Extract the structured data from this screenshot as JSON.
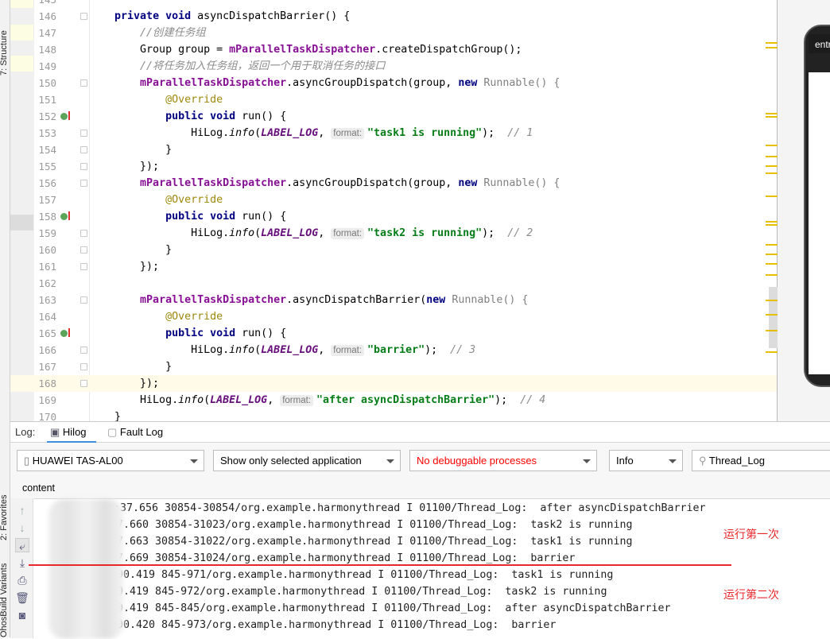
{
  "tool_windows": {
    "structure": "7: Structure",
    "favorites": "2: Favorites",
    "build_variants": "OhosBuild Variants"
  },
  "editor": {
    "current_line": 168,
    "lines": [
      {
        "n": "145",
        "tokens": []
      },
      {
        "n": "146",
        "tokens": [
          [
            "    ",
            ""
          ],
          [
            "private void ",
            "kw"
          ],
          [
            "asyncDispatchBarrier() {",
            ""
          ]
        ]
      },
      {
        "n": "147",
        "tokens": [
          [
            "        ",
            ""
          ],
          [
            "//创建任务组",
            "cm"
          ]
        ]
      },
      {
        "n": "148",
        "tokens": [
          [
            "        Group group = ",
            ""
          ],
          [
            "mParallelTaskDispatcher",
            "fld"
          ],
          [
            ".createDispatchGroup();",
            ""
          ]
        ]
      },
      {
        "n": "149",
        "tokens": [
          [
            "        ",
            ""
          ],
          [
            "//将任务加入任务组，返回一个用于取消任务的接口",
            "cm"
          ]
        ]
      },
      {
        "n": "150",
        "tokens": [
          [
            "        ",
            ""
          ],
          [
            "mParallelTaskDispatcher",
            "fld"
          ],
          [
            ".asyncGroupDispatch(group, ",
            ""
          ],
          [
            "new ",
            "kw"
          ],
          [
            "Runnable() {",
            "gray"
          ]
        ]
      },
      {
        "n": "151",
        "tokens": [
          [
            "            ",
            ""
          ],
          [
            "@Override",
            "ann"
          ]
        ]
      },
      {
        "n": "152",
        "tokens": [
          [
            "            ",
            ""
          ],
          [
            "public void ",
            "kw"
          ],
          [
            "run() {",
            ""
          ]
        ]
      },
      {
        "n": "153",
        "tokens": [
          [
            "                HiLog.",
            ""
          ],
          [
            "info",
            "ital"
          ],
          [
            "(",
            ""
          ],
          [
            "LABEL_LOG",
            "fldi"
          ],
          [
            ", ",
            ""
          ],
          [
            "format:",
            "hint"
          ],
          [
            "\"task1 is running\"",
            "str"
          ],
          [
            ");  ",
            ""
          ],
          [
            "// 1",
            "num"
          ]
        ]
      },
      {
        "n": "154",
        "tokens": [
          [
            "            }",
            ""
          ]
        ]
      },
      {
        "n": "155",
        "tokens": [
          [
            "        });",
            ""
          ]
        ]
      },
      {
        "n": "156",
        "tokens": [
          [
            "        ",
            ""
          ],
          [
            "mParallelTaskDispatcher",
            "fld"
          ],
          [
            ".asyncGroupDispatch(group, ",
            ""
          ],
          [
            "new ",
            "kw"
          ],
          [
            "Runnable() {",
            "gray"
          ]
        ]
      },
      {
        "n": "157",
        "tokens": [
          [
            "            ",
            ""
          ],
          [
            "@Override",
            "ann"
          ]
        ]
      },
      {
        "n": "158",
        "tokens": [
          [
            "            ",
            ""
          ],
          [
            "public void ",
            "kw"
          ],
          [
            "run() {",
            ""
          ]
        ]
      },
      {
        "n": "159",
        "tokens": [
          [
            "                HiLog.",
            ""
          ],
          [
            "info",
            "ital"
          ],
          [
            "(",
            ""
          ],
          [
            "LABEL_LOG",
            "fldi"
          ],
          [
            ", ",
            ""
          ],
          [
            "format:",
            "hint"
          ],
          [
            "\"task2 is running\"",
            "str"
          ],
          [
            ");  ",
            ""
          ],
          [
            "// 2",
            "num"
          ]
        ]
      },
      {
        "n": "160",
        "tokens": [
          [
            "            }",
            ""
          ]
        ]
      },
      {
        "n": "161",
        "tokens": [
          [
            "        });",
            ""
          ]
        ]
      },
      {
        "n": "162",
        "tokens": []
      },
      {
        "n": "163",
        "tokens": [
          [
            "        ",
            ""
          ],
          [
            "mParallelTaskDispatcher",
            "fld"
          ],
          [
            ".asyncDispatchBarrier(",
            ""
          ],
          [
            "new ",
            "kw"
          ],
          [
            "Runnable() {",
            "gray"
          ]
        ]
      },
      {
        "n": "164",
        "tokens": [
          [
            "            ",
            ""
          ],
          [
            "@Override",
            "ann"
          ]
        ]
      },
      {
        "n": "165",
        "tokens": [
          [
            "            ",
            ""
          ],
          [
            "public void ",
            "kw"
          ],
          [
            "run() {",
            ""
          ]
        ]
      },
      {
        "n": "166",
        "tokens": [
          [
            "                HiLog.",
            ""
          ],
          [
            "info",
            "ital"
          ],
          [
            "(",
            ""
          ],
          [
            "LABEL_LOG",
            "fldi"
          ],
          [
            ", ",
            ""
          ],
          [
            "format:",
            "hint"
          ],
          [
            "\"barrier\"",
            "str"
          ],
          [
            ");  ",
            ""
          ],
          [
            "// 3",
            "num"
          ]
        ]
      },
      {
        "n": "167",
        "tokens": [
          [
            "            }",
            ""
          ]
        ]
      },
      {
        "n": "168",
        "tokens": [
          [
            "        });",
            ""
          ]
        ]
      },
      {
        "n": "169",
        "tokens": [
          [
            "        HiLog.",
            ""
          ],
          [
            "info",
            "ital"
          ],
          [
            "(",
            ""
          ],
          [
            "LABEL_LOG",
            "fldi"
          ],
          [
            ", ",
            ""
          ],
          [
            "format:",
            "hint"
          ],
          [
            "\"after asyncDispatchBarrier\"",
            "str"
          ],
          [
            ");  ",
            ""
          ],
          [
            "// 4",
            "num"
          ]
        ]
      },
      {
        "n": "170",
        "tokens": [
          [
            "    }",
            ""
          ]
        ]
      }
    ]
  },
  "preview": {
    "app_title": "entry"
  },
  "log_panel": {
    "label": "Log:",
    "tabs": [
      {
        "label": "Hilog",
        "active": true
      },
      {
        "label": "Fault Log",
        "active": false
      }
    ],
    "device": "HUAWEI TAS-AL00",
    "app_filter": "Show only selected application",
    "process": "No debuggable processes",
    "process_color": "#ff0000",
    "level": "Info",
    "search": "Thread_Log",
    "column_header": "content",
    "lines": [
      ":37.656 30854-30854/org.example.harmonythread I 01100/Thread_Log:  after asyncDispatchBarrier",
      ":05:37.660 30854-31023/org.example.harmonythread I 01100/Thread_Log:  task2 is running",
      "05:37.663 30854-31022/org.example.harmonythread I 01100/Thread_Log:  task1 is running",
      ":05:37.669 30854-31024/org.example.harmonythread I 01100/Thread_Log:  barrier",
      "06:00.419 845-971/org.example.harmonythread I 01100/Thread_Log:  task1 is running",
      ":06:00.419 845-972/org.example.harmonythread I 01100/Thread_Log:  task2 is running",
      ":06:00.419 845-845/org.example.harmonythread I 01100/Thread_Log:  after asyncDispatchBarrier",
      "06:00.420 845-973/org.example.harmonythread I 01100/Thread_Log:  barrier"
    ]
  },
  "annotations": {
    "first_run": "运行第一次",
    "second_run": "运行第二次",
    "color": "#e8282c"
  }
}
